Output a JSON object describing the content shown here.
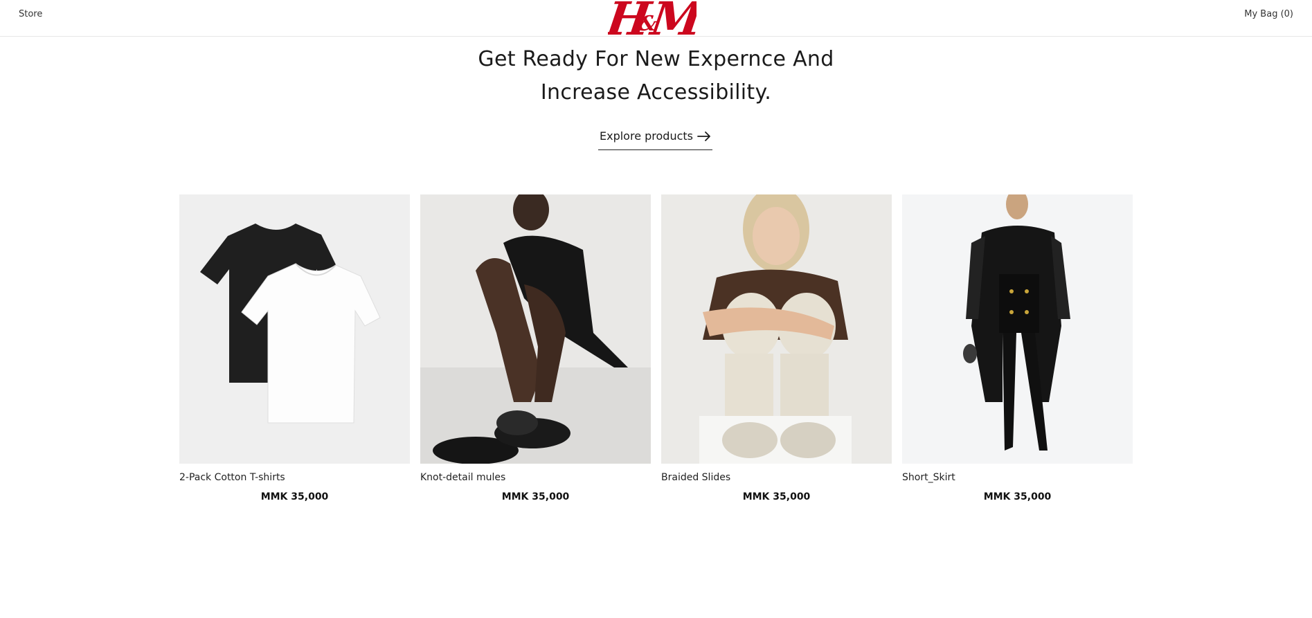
{
  "header": {
    "store_label": "Store",
    "bag_label": "My Bag (0)",
    "logo_text": "H&M",
    "logo_color": "#cc071e"
  },
  "hero": {
    "title_line1": "Get Ready For New Expernce And",
    "title_line2": "Increase Accessibility.",
    "cta_label": "Explore products",
    "cta_icon": "arrow-right-icon"
  },
  "products": [
    {
      "name": "2-Pack Cotton T-shirts",
      "price": "MMK 35,000"
    },
    {
      "name": "Knot-detail mules",
      "price": "MMK 35,000"
    },
    {
      "name": "Braided Slides",
      "price": "MMK 35,000"
    },
    {
      "name": "Short_Skirt",
      "price": "MMK 35,000"
    }
  ]
}
